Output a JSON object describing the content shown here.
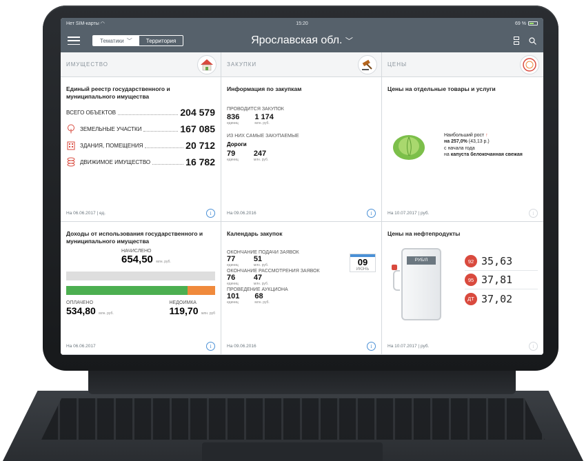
{
  "status": {
    "carrier": "Нет SIM-карты",
    "time": "15:20",
    "battery": "69 %"
  },
  "nav": {
    "tabs": [
      {
        "label": "Тематики",
        "active": true
      },
      {
        "label": "Территория",
        "active": false
      }
    ],
    "region": "Ярославская обл."
  },
  "columns": {
    "property": {
      "header": "ИМУЩЕСТВО",
      "icon": "house-icon"
    },
    "purchases": {
      "header": "ЗАКУПКИ",
      "icon": "gavel-icon"
    },
    "prices": {
      "header": "ЦЕНЫ",
      "icon": "price-tag-icon"
    }
  },
  "registry": {
    "title": "Единый реестр государственного и муниципального имущества",
    "total_label": "ВСЕГО ОБЪЕКТОВ",
    "total_value": "204 579",
    "items": [
      {
        "label": "ЗЕМЕЛЬНЫЕ УЧАСТКИ",
        "value": "167 085",
        "icon": "tree-icon"
      },
      {
        "label": "ЗДАНИЯ, ПОМЕЩЕНИЯ",
        "value": "20 712",
        "icon": "building-icon"
      },
      {
        "label": "ДВИЖИМОЕ ИМУЩЕСТВО",
        "value": "16 782",
        "icon": "coins-icon"
      }
    ],
    "footer": "На 06.06.2017  |  ед."
  },
  "income": {
    "title": "Доходы от использования государственного и муниципального имущества",
    "accrued_label": "НАЧИСЛЕНО",
    "accrued_int": "654",
    "accrued_dec": ",50",
    "accrued_unit": "млн. руб.",
    "paid_label": "ОПЛАЧЕНО",
    "paid_int": "534",
    "paid_dec": ",80",
    "paid_unit": "млн. руб.",
    "arrears_label": "НЕДОИМКА",
    "arrears_int": "119",
    "arrears_dec": ",70",
    "arrears_unit": "млн. руб",
    "paid_share": 0.817,
    "footer": "На 06.06.2017"
  },
  "purchase_info": {
    "title": "Информация по закупкам",
    "ongoing_label": "ПРОВОДИТСЯ ЗАКУПОК",
    "ongoing_count": "836",
    "ongoing_count_unit": "единиц",
    "ongoing_sum": "1 174",
    "ongoing_sum_unit": "млн. руб.",
    "top_label": "ИЗ НИХ САМЫЕ ЗАКУПАЕМЫЕ",
    "top_name": "Дороги",
    "top_count": "79",
    "top_count_unit": "единиц",
    "top_sum": "247",
    "top_sum_unit": "млн. руб.",
    "footer": "На 09.06.2016"
  },
  "calendar": {
    "title": "Календарь закупок",
    "date_day": "09",
    "date_month": "ИЮНЬ",
    "rows": [
      {
        "label": "ОКОНЧАНИЕ ПОДАЧИ ЗАЯВОК",
        "count": "77",
        "count_unit": "единиц",
        "sum": "51",
        "sum_unit": "млн. руб."
      },
      {
        "label": "ОКОНЧАНИЕ РАССМОТРЕНИЯ ЗАЯВОК",
        "count": "76",
        "count_unit": "единиц",
        "sum": "47",
        "sum_unit": "млн. руб."
      },
      {
        "label": "ПРОВЕДЕНИЕ АУКЦИОНА",
        "count": "101",
        "count_unit": "единиц",
        "sum": "68",
        "sum_unit": "млн. руб."
      }
    ],
    "footer": "На 09.06.2016"
  },
  "goods_prices": {
    "title": "Цены на отдельные товары и услуги",
    "growth_label": "Наибольший рост",
    "growth_value": "на 257,0%",
    "growth_abs": "(43,13 р.)",
    "since": "с начала года",
    "on_prefix": "на",
    "product": "капуста белокочанная свежая",
    "footer": "На 10.07.2017  |  руб."
  },
  "fuel": {
    "title": "Цены на нефтепродукты",
    "pump_label": "РУБ/Л",
    "items": [
      {
        "grade": "92",
        "price": "35,63"
      },
      {
        "grade": "95",
        "price": "37,81"
      },
      {
        "grade": "ДТ",
        "price": "37,02"
      }
    ],
    "footer": "На 10.07.2017  |  руб."
  },
  "colors": {
    "nav": "#56616b",
    "accent_red": "#d94a3e",
    "bar_green": "#4caf50",
    "bar_orange": "#f08a3c",
    "info_blue": "#4a90d6"
  }
}
